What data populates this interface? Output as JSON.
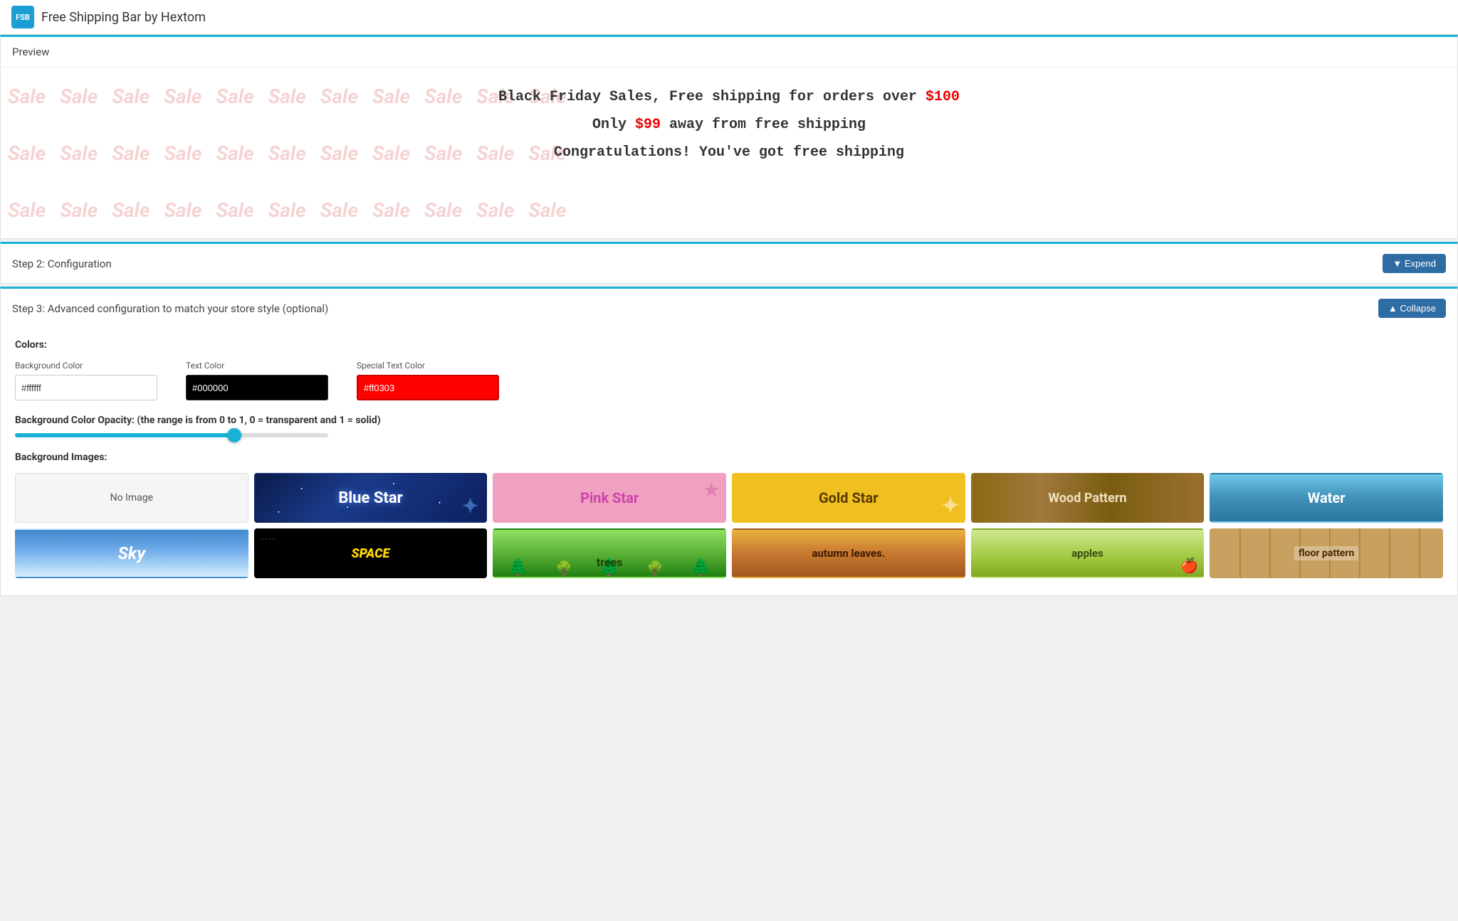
{
  "app": {
    "logo": "FSB",
    "title": "Free Shipping Bar by Hextom"
  },
  "preview": {
    "label": "Preview",
    "messages": [
      {
        "text_before": "Black Friday Sales, Free shipping for orders over ",
        "highlight": "$100",
        "text_after": ""
      },
      {
        "text_before": "Only ",
        "highlight": "$99",
        "text_after": " away from free shipping"
      },
      {
        "text_before": "Congratulations! You've got free shipping",
        "highlight": "",
        "text_after": ""
      }
    ]
  },
  "step2": {
    "title": "Step 2: Configuration",
    "button_label": "▼ Expend"
  },
  "step3": {
    "title": "Step 3: Advanced configuration to match your store style (optional)",
    "button_label": "▲ Collapse",
    "colors_label": "Colors:",
    "bg_color_label": "Background Color",
    "bg_color_value": "#ffffff",
    "text_color_label": "Text Color",
    "text_color_value": "#000000",
    "special_text_color_label": "Special Text Color",
    "special_text_color_value": "#ff0303",
    "opacity_label": "Background Color Opacity: (the range is from 0 to 1, 0 = transparent and 1 = solid)",
    "bg_images_label": "Background Images:",
    "bg_images": [
      {
        "id": "no-image",
        "label": "No Image",
        "style": "no-image"
      },
      {
        "id": "blue-star",
        "label": "Blue Star",
        "style": "blue-star"
      },
      {
        "id": "pink-star",
        "label": "Pink Star",
        "style": "pink-star"
      },
      {
        "id": "gold-star",
        "label": "Gold Star",
        "style": "gold-star"
      },
      {
        "id": "wood-pattern",
        "label": "Wood Pattern",
        "style": "wood"
      },
      {
        "id": "water",
        "label": "Water",
        "style": "water"
      },
      {
        "id": "sky",
        "label": "Sky",
        "style": "sky"
      },
      {
        "id": "space",
        "label": "SPACE",
        "style": "space"
      },
      {
        "id": "trees",
        "label": "trees",
        "style": "trees"
      },
      {
        "id": "autumn-leaves",
        "label": "autumn leaves.",
        "style": "autumn"
      },
      {
        "id": "apples",
        "label": "apples",
        "style": "apples"
      },
      {
        "id": "floor-pattern",
        "label": "floor pattern",
        "style": "floor"
      }
    ]
  }
}
